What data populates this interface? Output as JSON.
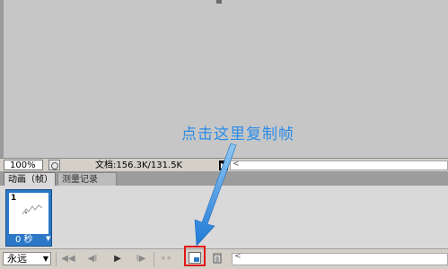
{
  "statusbar": {
    "zoom": "100%",
    "doc_label": "文档:",
    "doc_size": "156.3K/131.5K",
    "menu_arrow": "▶",
    "scroll_glyph": "<"
  },
  "panel": {
    "tabs": [
      {
        "label": "动画（帧）",
        "active": true
      },
      {
        "label": "测量记录",
        "active": false
      }
    ]
  },
  "frames": [
    {
      "number": "1",
      "delay": "0 秒",
      "delay_arrow": "▼"
    }
  ],
  "controls": {
    "loop": "永远",
    "loop_arrow": "▼",
    "first": "◀◀",
    "prev": "◀I",
    "play": "▶",
    "next": "I▶",
    "tween": "∘∘",
    "scroll_glyph": "<"
  },
  "annotation": {
    "text": "点击这里复制帧",
    "color": "#2b8ce8"
  },
  "colors": {
    "highlight": "#e01818",
    "frame_selected": "#2b78c7"
  }
}
